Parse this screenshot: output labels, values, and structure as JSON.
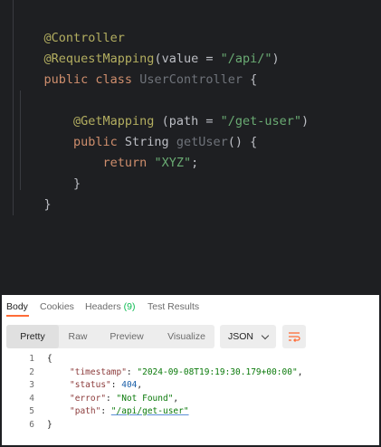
{
  "editor": {
    "lines": [
      {
        "parts": [
          {
            "t": "@Controller",
            "c": "ann"
          }
        ]
      },
      {
        "parts": [
          {
            "t": "@RequestMapping",
            "c": "ann"
          },
          {
            "t": "(value = ",
            "c": "txt"
          },
          {
            "t": "\"/api/\"",
            "c": "str"
          },
          {
            "t": ")",
            "c": "txt"
          }
        ]
      },
      {
        "parts": [
          {
            "t": "public class ",
            "c": "kw"
          },
          {
            "t": "UserController",
            "c": "cls"
          },
          {
            "t": " {",
            "c": "txt"
          }
        ]
      },
      {
        "parts": []
      },
      {
        "parts": [
          {
            "t": "    @GetMapping",
            "c": "ann"
          },
          {
            "t": " (path = ",
            "c": "txt"
          },
          {
            "t": "\"/get-user\"",
            "c": "str"
          },
          {
            "t": ")",
            "c": "txt"
          }
        ]
      },
      {
        "parts": [
          {
            "t": "    public ",
            "c": "kw"
          },
          {
            "t": "String ",
            "c": "txt"
          },
          {
            "t": "getUser",
            "c": "mth"
          },
          {
            "t": "() {",
            "c": "txt"
          }
        ]
      },
      {
        "parts": [
          {
            "t": "        return ",
            "c": "kw"
          },
          {
            "t": "\"XYZ\"",
            "c": "str"
          },
          {
            "t": ";",
            "c": "txt"
          }
        ]
      },
      {
        "parts": [
          {
            "t": "    }",
            "c": "txt"
          }
        ]
      },
      {
        "parts": [
          {
            "t": "}",
            "c": "txt"
          }
        ]
      }
    ]
  },
  "response": {
    "tabs": [
      {
        "label": "Body",
        "active": true
      },
      {
        "label": "Cookies",
        "active": false
      },
      {
        "label": "Headers",
        "count": "(9)",
        "active": false
      },
      {
        "label": "Test Results",
        "active": false
      }
    ],
    "view_modes": [
      {
        "label": "Pretty",
        "active": true
      },
      {
        "label": "Raw",
        "active": false
      },
      {
        "label": "Preview",
        "active": false
      },
      {
        "label": "Visualize",
        "active": false
      }
    ],
    "format": "JSON",
    "wrap_icon": "wrap-lines-icon",
    "body_lines": [
      {
        "num": "1",
        "text": "{"
      },
      {
        "num": "2",
        "key": "\"timestamp\"",
        "value": "\"2024-09-08T19:19:30.179+00:00\"",
        "vtype": "str",
        "comma": true
      },
      {
        "num": "3",
        "key": "\"status\"",
        "value": "404",
        "vtype": "num",
        "comma": true
      },
      {
        "num": "4",
        "key": "\"error\"",
        "value": "\"Not Found\"",
        "vtype": "str",
        "comma": true
      },
      {
        "num": "5",
        "key": "\"path\"",
        "value": "\"/api/get-user\"",
        "vtype": "link",
        "comma": false
      },
      {
        "num": "6",
        "text": "}"
      }
    ]
  },
  "colors": {
    "editor_bg": "#1e1f22",
    "annotation": "#b3ae60",
    "keyword": "#cf8e6d",
    "string": "#6aab73",
    "accent": "#ff6c37",
    "count_green": "#0cbb52"
  }
}
